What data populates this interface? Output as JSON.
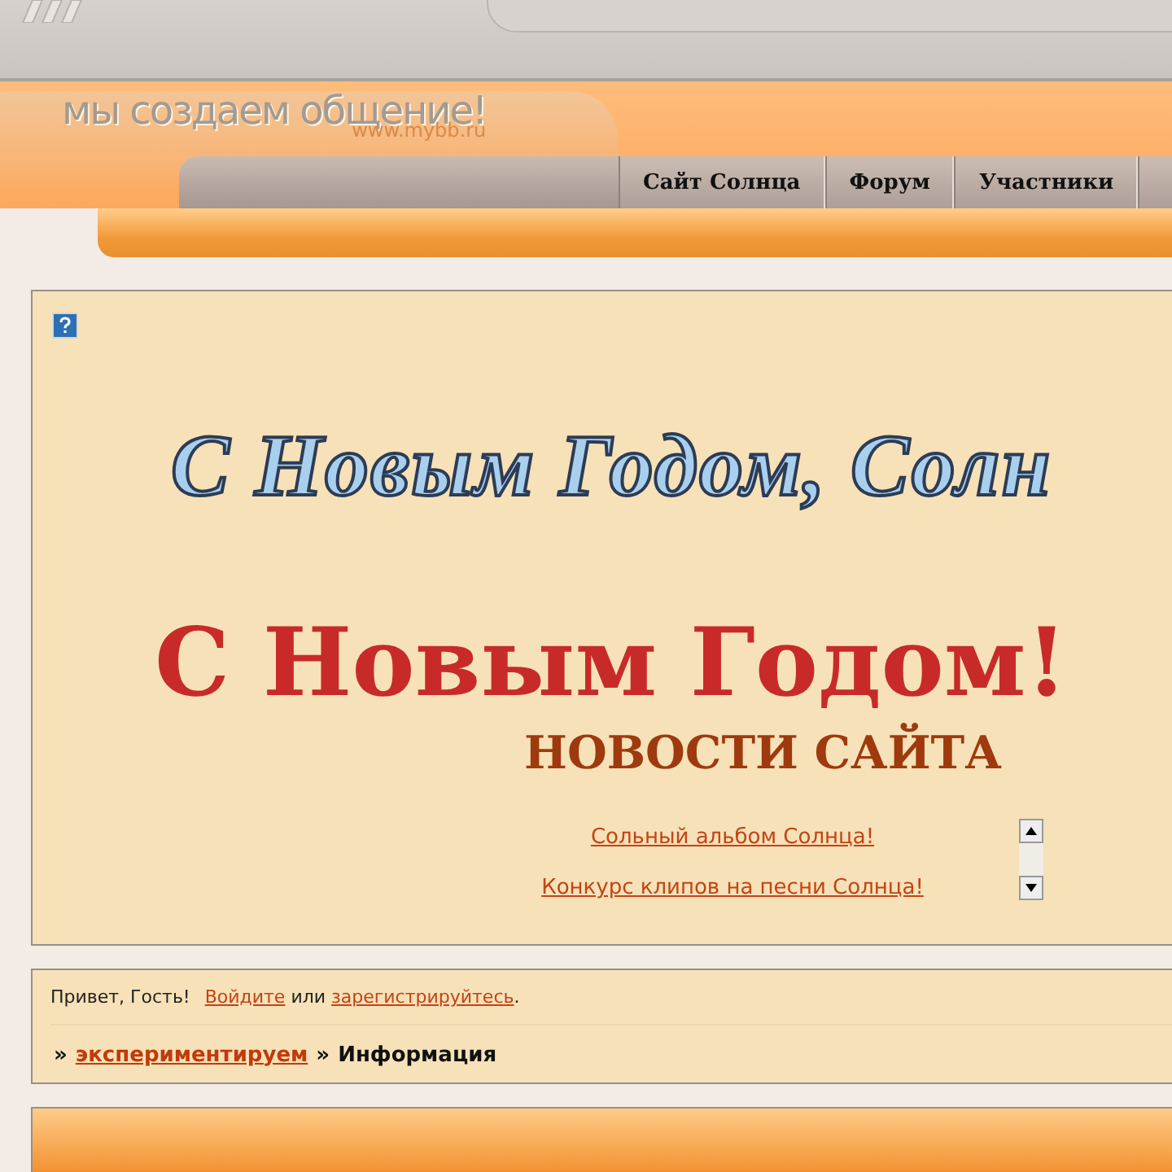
{
  "logo": {
    "slogan": "мы создаем общение!",
    "url": "www.mybb.ru"
  },
  "nav_tabs": [
    "Сайт Солнца",
    "Форум",
    "Участники"
  ],
  "announcement": {
    "banner_text": "С Новым Годом, Солн",
    "headline": "С Новым Годом!",
    "news_title": "НОВОСТИ САЙТА",
    "news_items": [
      "Сольный альбом Солнца!",
      "Конкурс клипов на песни Солнца!"
    ]
  },
  "welcome": {
    "greeting": "Привет, Гость!",
    "login_link": "Войдите",
    "or": "или",
    "register_link": "зарегистрируйтесь",
    "end": "."
  },
  "breadcrumb": [
    {
      "kind": "separator",
      "label": "»"
    },
    {
      "kind": "link",
      "label": "экспериментируем"
    },
    {
      "kind": "separator",
      "label": "»"
    },
    {
      "kind": "current",
      "label": "Информация"
    }
  ]
}
